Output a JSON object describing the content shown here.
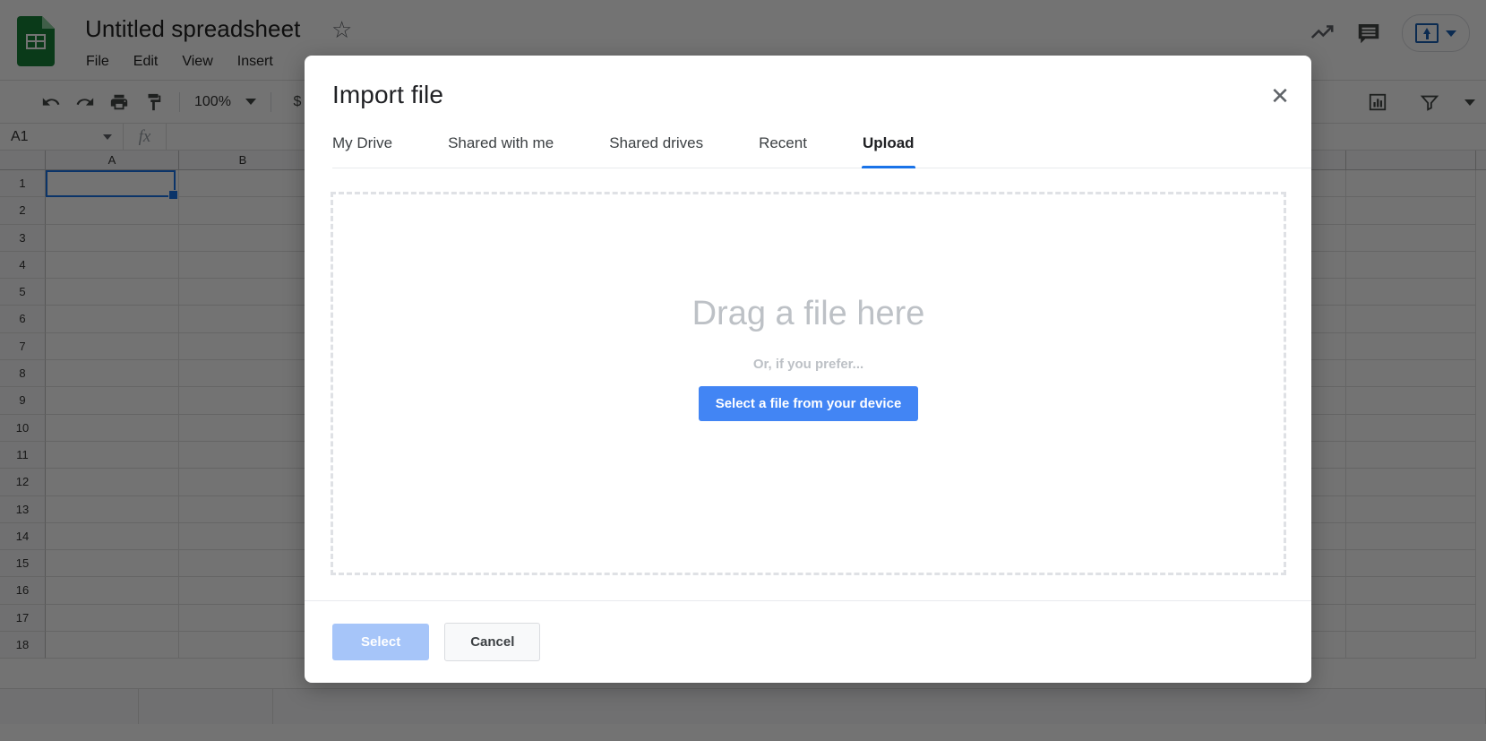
{
  "app": {
    "doc_title": "Untitled spreadsheet",
    "logo_icon": "sheets-logo-icon",
    "star_icon": "star-icon",
    "menus": [
      "File",
      "Edit",
      "View",
      "Insert"
    ],
    "header_icons": [
      "trending-up-icon",
      "comment-icon"
    ],
    "share_icon": "share-upload-icon",
    "share_caret_icon": "chevron-down-icon"
  },
  "toolbar": {
    "items": [
      "undo-icon",
      "redo-icon",
      "print-icon",
      "paint-format-icon"
    ],
    "zoom_value": "100%",
    "zoom_caret_icon": "chevron-down-icon",
    "currency_label": "$",
    "right_items": [
      "chart-icon",
      "filter-icon",
      "chevron-down-icon"
    ]
  },
  "formula_bar": {
    "name_box_value": "A1",
    "fx_label": "fx",
    "formula_value": ""
  },
  "grid": {
    "columns": [
      "A",
      "B"
    ],
    "rows": [
      "1",
      "2",
      "3",
      "4",
      "5",
      "6",
      "7",
      "8",
      "9",
      "10",
      "11",
      "12",
      "13",
      "14",
      "15",
      "16",
      "17",
      "18"
    ],
    "selected_cell": "A1",
    "selection_color": "#1a73e8"
  },
  "dialog": {
    "title": "Import file",
    "close_icon": "close-icon",
    "tabs": [
      {
        "label": "My Drive",
        "active": false
      },
      {
        "label": "Shared with me",
        "active": false
      },
      {
        "label": "Shared drives",
        "active": false
      },
      {
        "label": "Recent",
        "active": false
      },
      {
        "label": "Upload",
        "active": true
      }
    ],
    "dropzone": {
      "drag_text": "Drag a file here",
      "or_text": "Or, if you prefer...",
      "pick_button": "Select a file from your device",
      "pick_button_color": "#4285f4"
    },
    "footer": {
      "select_label": "Select",
      "select_disabled": true,
      "select_color": "#a6c5f9",
      "cancel_label": "Cancel"
    }
  }
}
